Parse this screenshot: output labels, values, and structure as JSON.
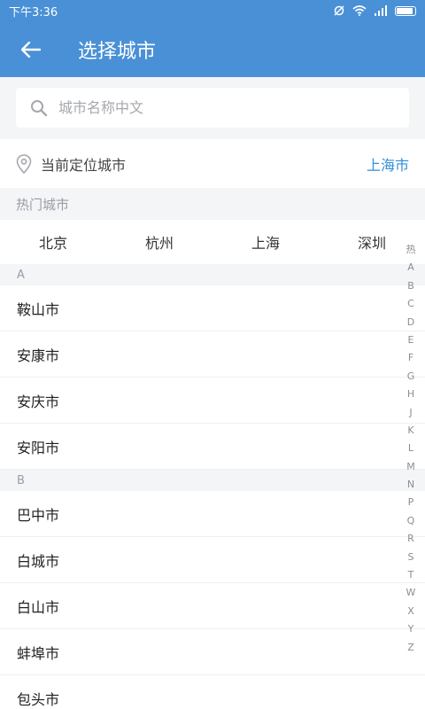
{
  "status_bar": {
    "time": "下午3:36"
  },
  "app_bar": {
    "title": "选择城市"
  },
  "search": {
    "placeholder": "城市名称中文"
  },
  "location": {
    "label": "当前定位城市",
    "city": "上海市"
  },
  "hot": {
    "header": "热门城市",
    "cities": [
      "北京",
      "杭州",
      "上海",
      "深圳"
    ]
  },
  "groups": [
    {
      "letter": "A",
      "cities": [
        "鞍山市",
        "安康市",
        "安庆市",
        "安阳市"
      ]
    },
    {
      "letter": "B",
      "cities": [
        "巴中市",
        "白城市",
        "白山市",
        "蚌埠市",
        "包头市"
      ]
    }
  ],
  "index_bar": [
    "热",
    "A",
    "B",
    "C",
    "D",
    "E",
    "F",
    "G",
    "H",
    "J",
    "K",
    "L",
    "M",
    "N",
    "P",
    "Q",
    "R",
    "S",
    "T",
    "W",
    "X",
    "Y",
    "Z"
  ],
  "colors": {
    "primary": "#4a90d6",
    "accent": "#2f8ed8",
    "section_bg": "#f3f5f7"
  }
}
